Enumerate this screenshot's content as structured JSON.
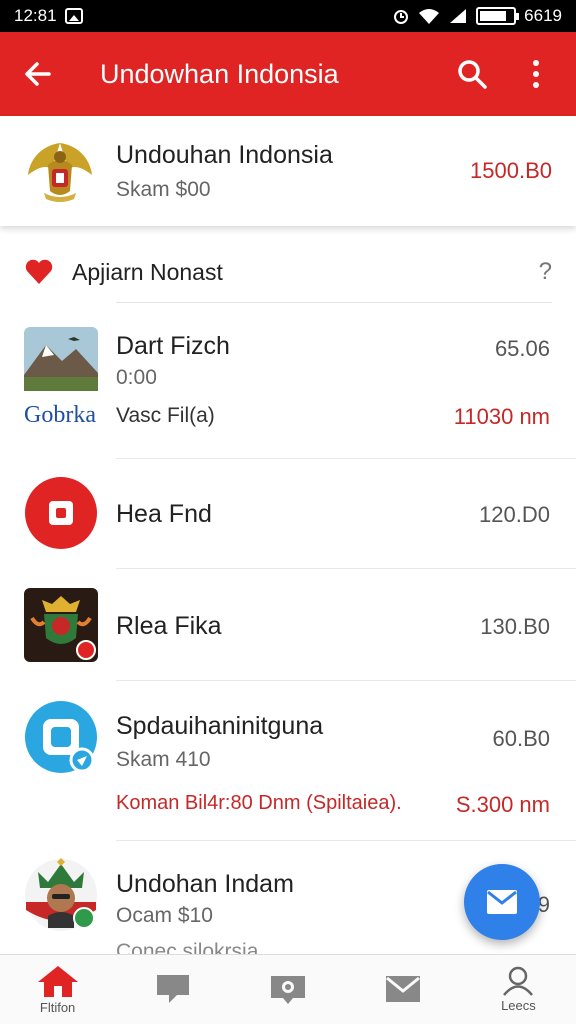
{
  "status_bar": {
    "time": "12:81",
    "battery_text": "6619"
  },
  "app_bar": {
    "title": "Undowhan Indonsia"
  },
  "header": {
    "title": "Undouhan Indonsia",
    "subtitle": "Skam $00",
    "amount": "1500.B0"
  },
  "section": {
    "title": "Apjiarn Nonast",
    "help": "?"
  },
  "items": [
    {
      "name": "Dart Fizch",
      "sub": "0:00",
      "amount": "65.06",
      "brand": "Gobrka",
      "detail": "Vasc Fil(a)",
      "detail_amount": "11030 nm"
    },
    {
      "name": "Hea Fnd",
      "amount": "120.D0"
    },
    {
      "name": "Rlea Fika",
      "amount": "130.B0"
    },
    {
      "name": "Spdauihaninitguna",
      "sub": "Skam 410",
      "amount": "60.B0",
      "detail": "Koman Bil4r:80 Dnm (Spiltaiea).",
      "detail_amount": "S.300 nm"
    },
    {
      "name": "Undohan Indam",
      "sub": "Ocam $10",
      "amount": "9",
      "detail": "Conec silokrsia"
    }
  ],
  "bottom_nav": [
    {
      "label": "Fltifon",
      "icon": "home-icon"
    },
    {
      "label": "",
      "icon": "flag-icon"
    },
    {
      "label": "",
      "icon": "camera-icon"
    },
    {
      "label": "",
      "icon": "mail-icon"
    },
    {
      "label": "Leecs",
      "icon": "person-icon"
    }
  ],
  "colors": {
    "primary": "#e02424",
    "accent": "#2f80e8",
    "amount_red": "#c62828"
  }
}
